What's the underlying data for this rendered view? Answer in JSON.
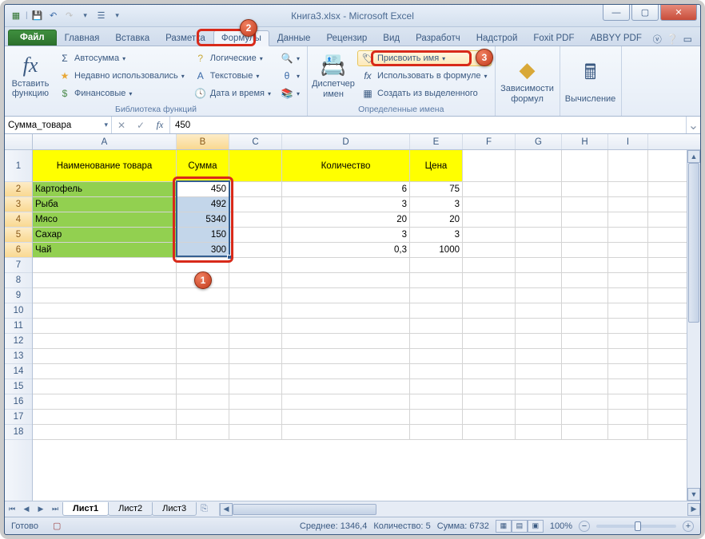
{
  "window": {
    "title_doc": "Книга3.xlsx",
    "title_app": "Microsoft Excel"
  },
  "tabs": {
    "file": "Файл",
    "items": [
      "Главная",
      "Вставка",
      "Разметка",
      "Формулы",
      "Данные",
      "Рецензир",
      "Вид",
      "Разработч",
      "Надстрой",
      "Foxit PDF",
      "ABBYY PDF"
    ],
    "active_index": 3
  },
  "ribbon": {
    "insert_fn_big": "Вставить функцию",
    "lib_group_label": "Библиотека функций",
    "lib": {
      "autosum": "Автосумма",
      "recent": "Недавно использовались",
      "financial": "Финансовые",
      "logical": "Логические",
      "text": "Текстовые",
      "datetime": "Дата и время"
    },
    "name_mgr_big": "Диспетчер имен",
    "names_group_label": "Определенные имена",
    "names": {
      "assign": "Присвоить имя",
      "use_in_formula": "Использовать в формуле",
      "create_from_sel": "Создать из выделенного"
    },
    "audit_big": "Зависимости формул",
    "calc_big": "Вычисление"
  },
  "formula_bar": {
    "name_box": "Сумма_товара",
    "value": "450"
  },
  "columns": [
    "A",
    "B",
    "C",
    "D",
    "E",
    "F",
    "G",
    "H",
    "I"
  ],
  "headers": {
    "name": "Наименование товара",
    "sum": "Сумма",
    "qty": "Количество",
    "price": "Цена"
  },
  "rows": [
    {
      "name": "Картофель",
      "sum": "450",
      "qty": "6",
      "price": "75"
    },
    {
      "name": "Рыба",
      "sum": "492",
      "qty": "3",
      "price": "3"
    },
    {
      "name": "Мясо",
      "sum": "5340",
      "qty": "20",
      "price": "20"
    },
    {
      "name": "Сахар",
      "sum": "150",
      "qty": "3",
      "price": "3"
    },
    {
      "name": "Чай",
      "sum": "300",
      "qty": "0,3",
      "price": "1000"
    }
  ],
  "sheets": {
    "nav": [
      "⏮",
      "◀",
      "▶",
      "⏭"
    ],
    "tabs": [
      "Лист1",
      "Лист2",
      "Лист3"
    ],
    "active": 0
  },
  "status": {
    "ready": "Готово",
    "avg_label": "Среднее:",
    "avg": "1346,4",
    "count_label": "Количество:",
    "count": "5",
    "sum_label": "Сумма:",
    "sum": "6732",
    "zoom": "100%"
  },
  "callouts": {
    "c1": "1",
    "c2": "2",
    "c3": "3"
  }
}
